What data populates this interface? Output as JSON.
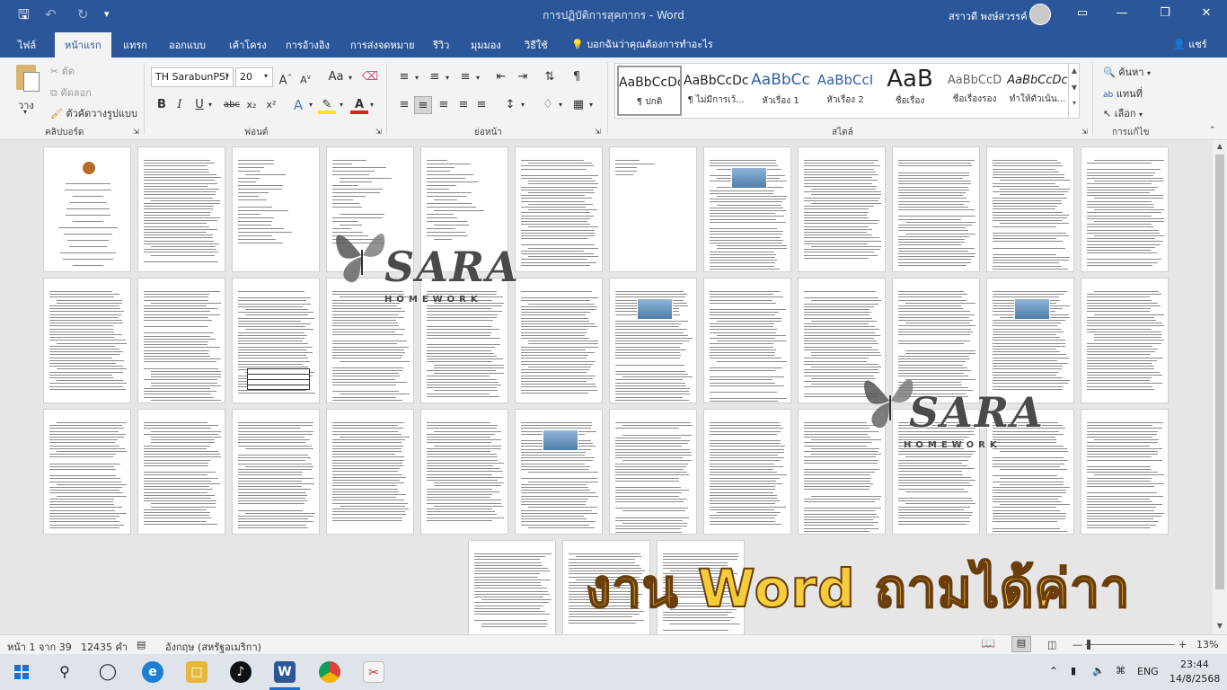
{
  "app": {
    "document_title": "การปฏิบัติการสุคกากร  -  Word",
    "user_name": "สราวดี พงษ์สวรรค์"
  },
  "tabs": [
    "ไฟล์",
    "หน้าแรก",
    "แทรก",
    "ออกแบบ",
    "เค้าโครง",
    "การอ้างอิง",
    "การส่งจดหมาย",
    "รีวิว",
    "มุมมอง",
    "วิธีใช้"
  ],
  "active_tab": "หน้าแรก",
  "tell_me": "บอกฉันว่าคุณต้องการทำอะไร",
  "share_label": "แชร์",
  "ribbon": {
    "clipboard": {
      "paste": "วาง",
      "cut": "ตัด",
      "copy": "คัดลอก",
      "format_painter": "ตัวคัดวางรูปแบบ",
      "label": "คลิปบอร์ด"
    },
    "font": {
      "name": "TH SarabunPSI",
      "size": "20",
      "label": "ฟอนต์",
      "case_btn": "Aa",
      "bold": "B",
      "italic": "I",
      "underline": "U",
      "strike": "abc",
      "sub": "x₂",
      "sup": "x²"
    },
    "paragraph": {
      "label": "ย่อหน้า"
    },
    "styles": {
      "label": "สไตล์",
      "items": [
        {
          "sample": "AaBbCcDc",
          "name": "¶ ปกติ"
        },
        {
          "sample": "AaBbCcDc",
          "name": "¶ ไม่มีการเว้..."
        },
        {
          "sample": "AaBbCc",
          "name": "หัวเรื่อง 1"
        },
        {
          "sample": "AaBbCcI",
          "name": "หัวเรื่อง 2"
        },
        {
          "sample": "AaB",
          "name": "ชื่อเรื่อง"
        },
        {
          "sample": "AaBbCcD",
          "name": "ชื่อเรื่องรอง"
        },
        {
          "sample": "AaBbCcDc",
          "name": "ทำให้ตัวเน้น..."
        }
      ]
    },
    "editing": {
      "label": "การแก้ไข",
      "find": "ค้นหา",
      "replace": "แทนที่",
      "select": "เลือก"
    }
  },
  "watermark": {
    "brand": "SARA",
    "sub": "HOMEWORK"
  },
  "promo_text": "งาน Word ถามได้ค่าา",
  "status": {
    "page": "หน้า 1 จาก 39",
    "words": "12435 คำ",
    "language": "อังกฤษ (สหรัฐอเมริกา)",
    "zoom": "13%"
  },
  "taskbar": {
    "lang": "ENG",
    "time": "23:44",
    "date": "14/8/2568"
  },
  "colors": {
    "word_blue": "#2b579a",
    "promo_yellow": "#f5cd3a"
  }
}
